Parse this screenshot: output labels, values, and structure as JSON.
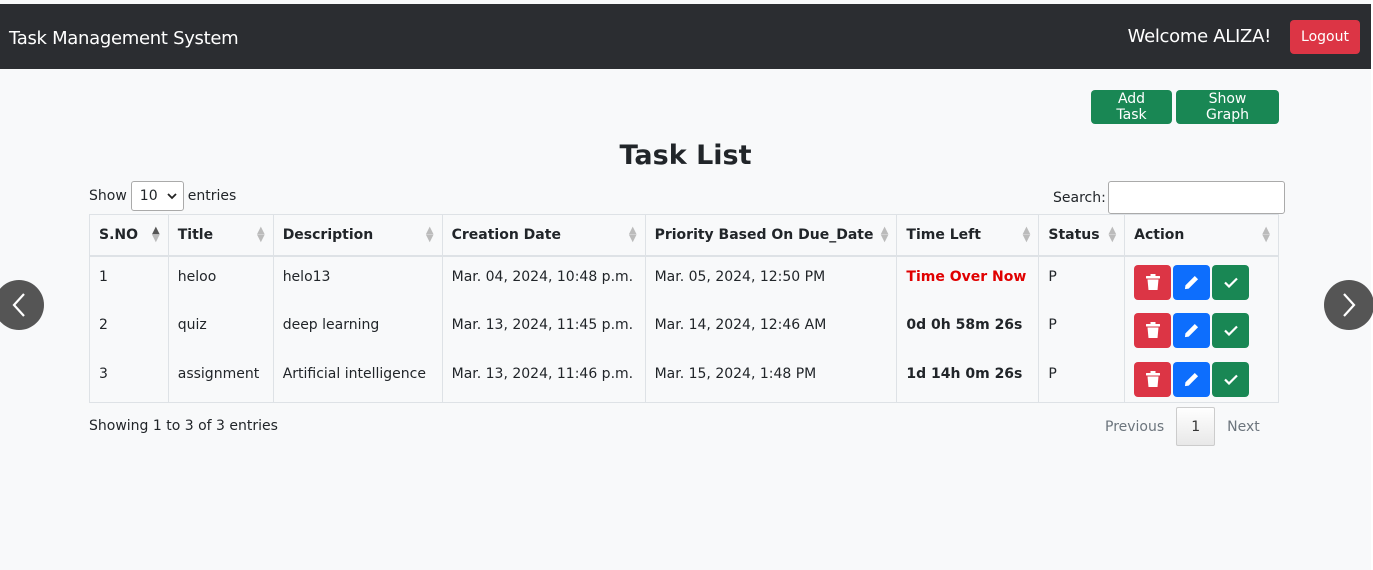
{
  "navbar": {
    "brand": "Task Management System",
    "welcome": "Welcome ALIZA!",
    "logout_label": "Logout"
  },
  "toolbar": {
    "add_task_label": "Add Task",
    "show_graph_label": "Show Graph"
  },
  "page_title": "Task List",
  "length": {
    "show_label": "Show",
    "selected": "10",
    "entries_label": "entries"
  },
  "search": {
    "label": "Search:",
    "value": ""
  },
  "table": {
    "columns": [
      "S.NO",
      "Title",
      "Description",
      "Creation Date",
      "Priority Based On Due_Date",
      "Time Left",
      "Status",
      "Action"
    ],
    "rows": [
      {
        "sno": "1",
        "title": "heloo",
        "description": "helo13",
        "creation_date": "Mar. 04, 2024, 10:48 p.m.",
        "priority": "Mar. 05, 2024, 12:50 PM",
        "time_left": "Time Over Now",
        "status": "P"
      },
      {
        "sno": "2",
        "title": "quiz",
        "description": "deep learning",
        "creation_date": "Mar. 13, 2024, 11:45 p.m.",
        "priority": "Mar. 14, 2024, 12:46 AM",
        "time_left": "0d 0h 58m 26s",
        "status": "P"
      },
      {
        "sno": "3",
        "title": "assignment",
        "description": "Artificial intelligence",
        "creation_date": "Mar. 13, 2024, 11:46 p.m.",
        "priority": "Mar. 15, 2024, 1:48 PM",
        "time_left": "1d 14h 0m 26s",
        "status": "P"
      }
    ]
  },
  "footer": {
    "info": "Showing 1 to 3 of 3 entries",
    "previous": "Previous",
    "current_page": "1",
    "next": "Next"
  },
  "colors": {
    "navbar": "#2b2d31",
    "danger": "#dc3545",
    "primary": "#0d6efd",
    "success": "#198754",
    "overdue_text": "#e00000"
  },
  "icons": {
    "delete": "trash-icon",
    "edit": "pencil-icon",
    "complete": "check-icon",
    "carousel_prev": "chevron-left-icon",
    "carousel_next": "chevron-right-icon"
  }
}
